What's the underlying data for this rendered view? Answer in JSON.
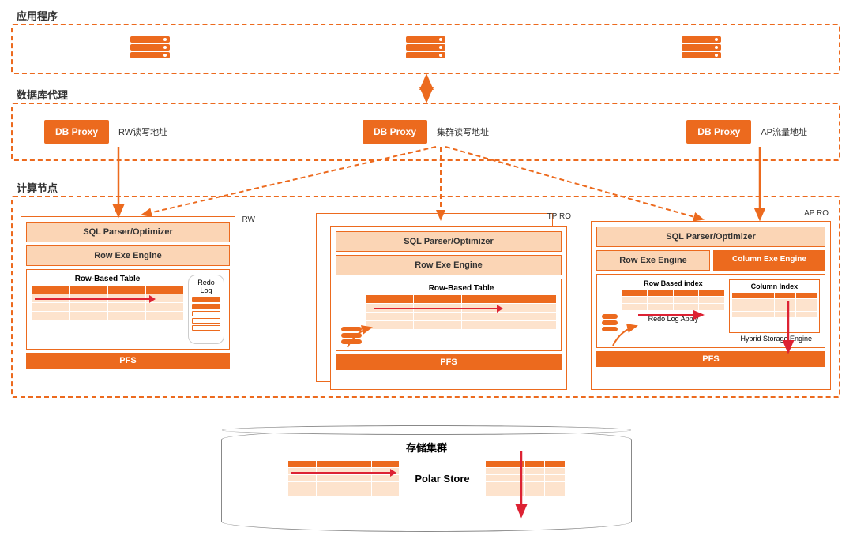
{
  "sections": {
    "app": "应用程序",
    "dbproxy": "数据库代理",
    "compute": "计算节点"
  },
  "proxy": {
    "label": "DB Proxy",
    "addr_rw": "RW读写地址",
    "addr_cluster": "集群读写地址",
    "addr_ap": "AP流量地址"
  },
  "node": {
    "rw": "RW",
    "tp_ro": "TP RO",
    "ap_ro": "AP RO",
    "sql_parser": "SQL Parser/Optimizer",
    "row_engine": "Row Exe Engine",
    "col_engine": "Column Exe Engine",
    "row_based_table": "Row-Based Table",
    "row_based_index": "Row Based index",
    "column_index": "Column Index",
    "redo_log": "Redo Log",
    "redo_apply": "Redo Log Apply",
    "hybrid_storage": "Hybrid Storage  Engine",
    "pfs": "PFS"
  },
  "storage": {
    "title": "存储集群",
    "name": "Polar Store"
  }
}
